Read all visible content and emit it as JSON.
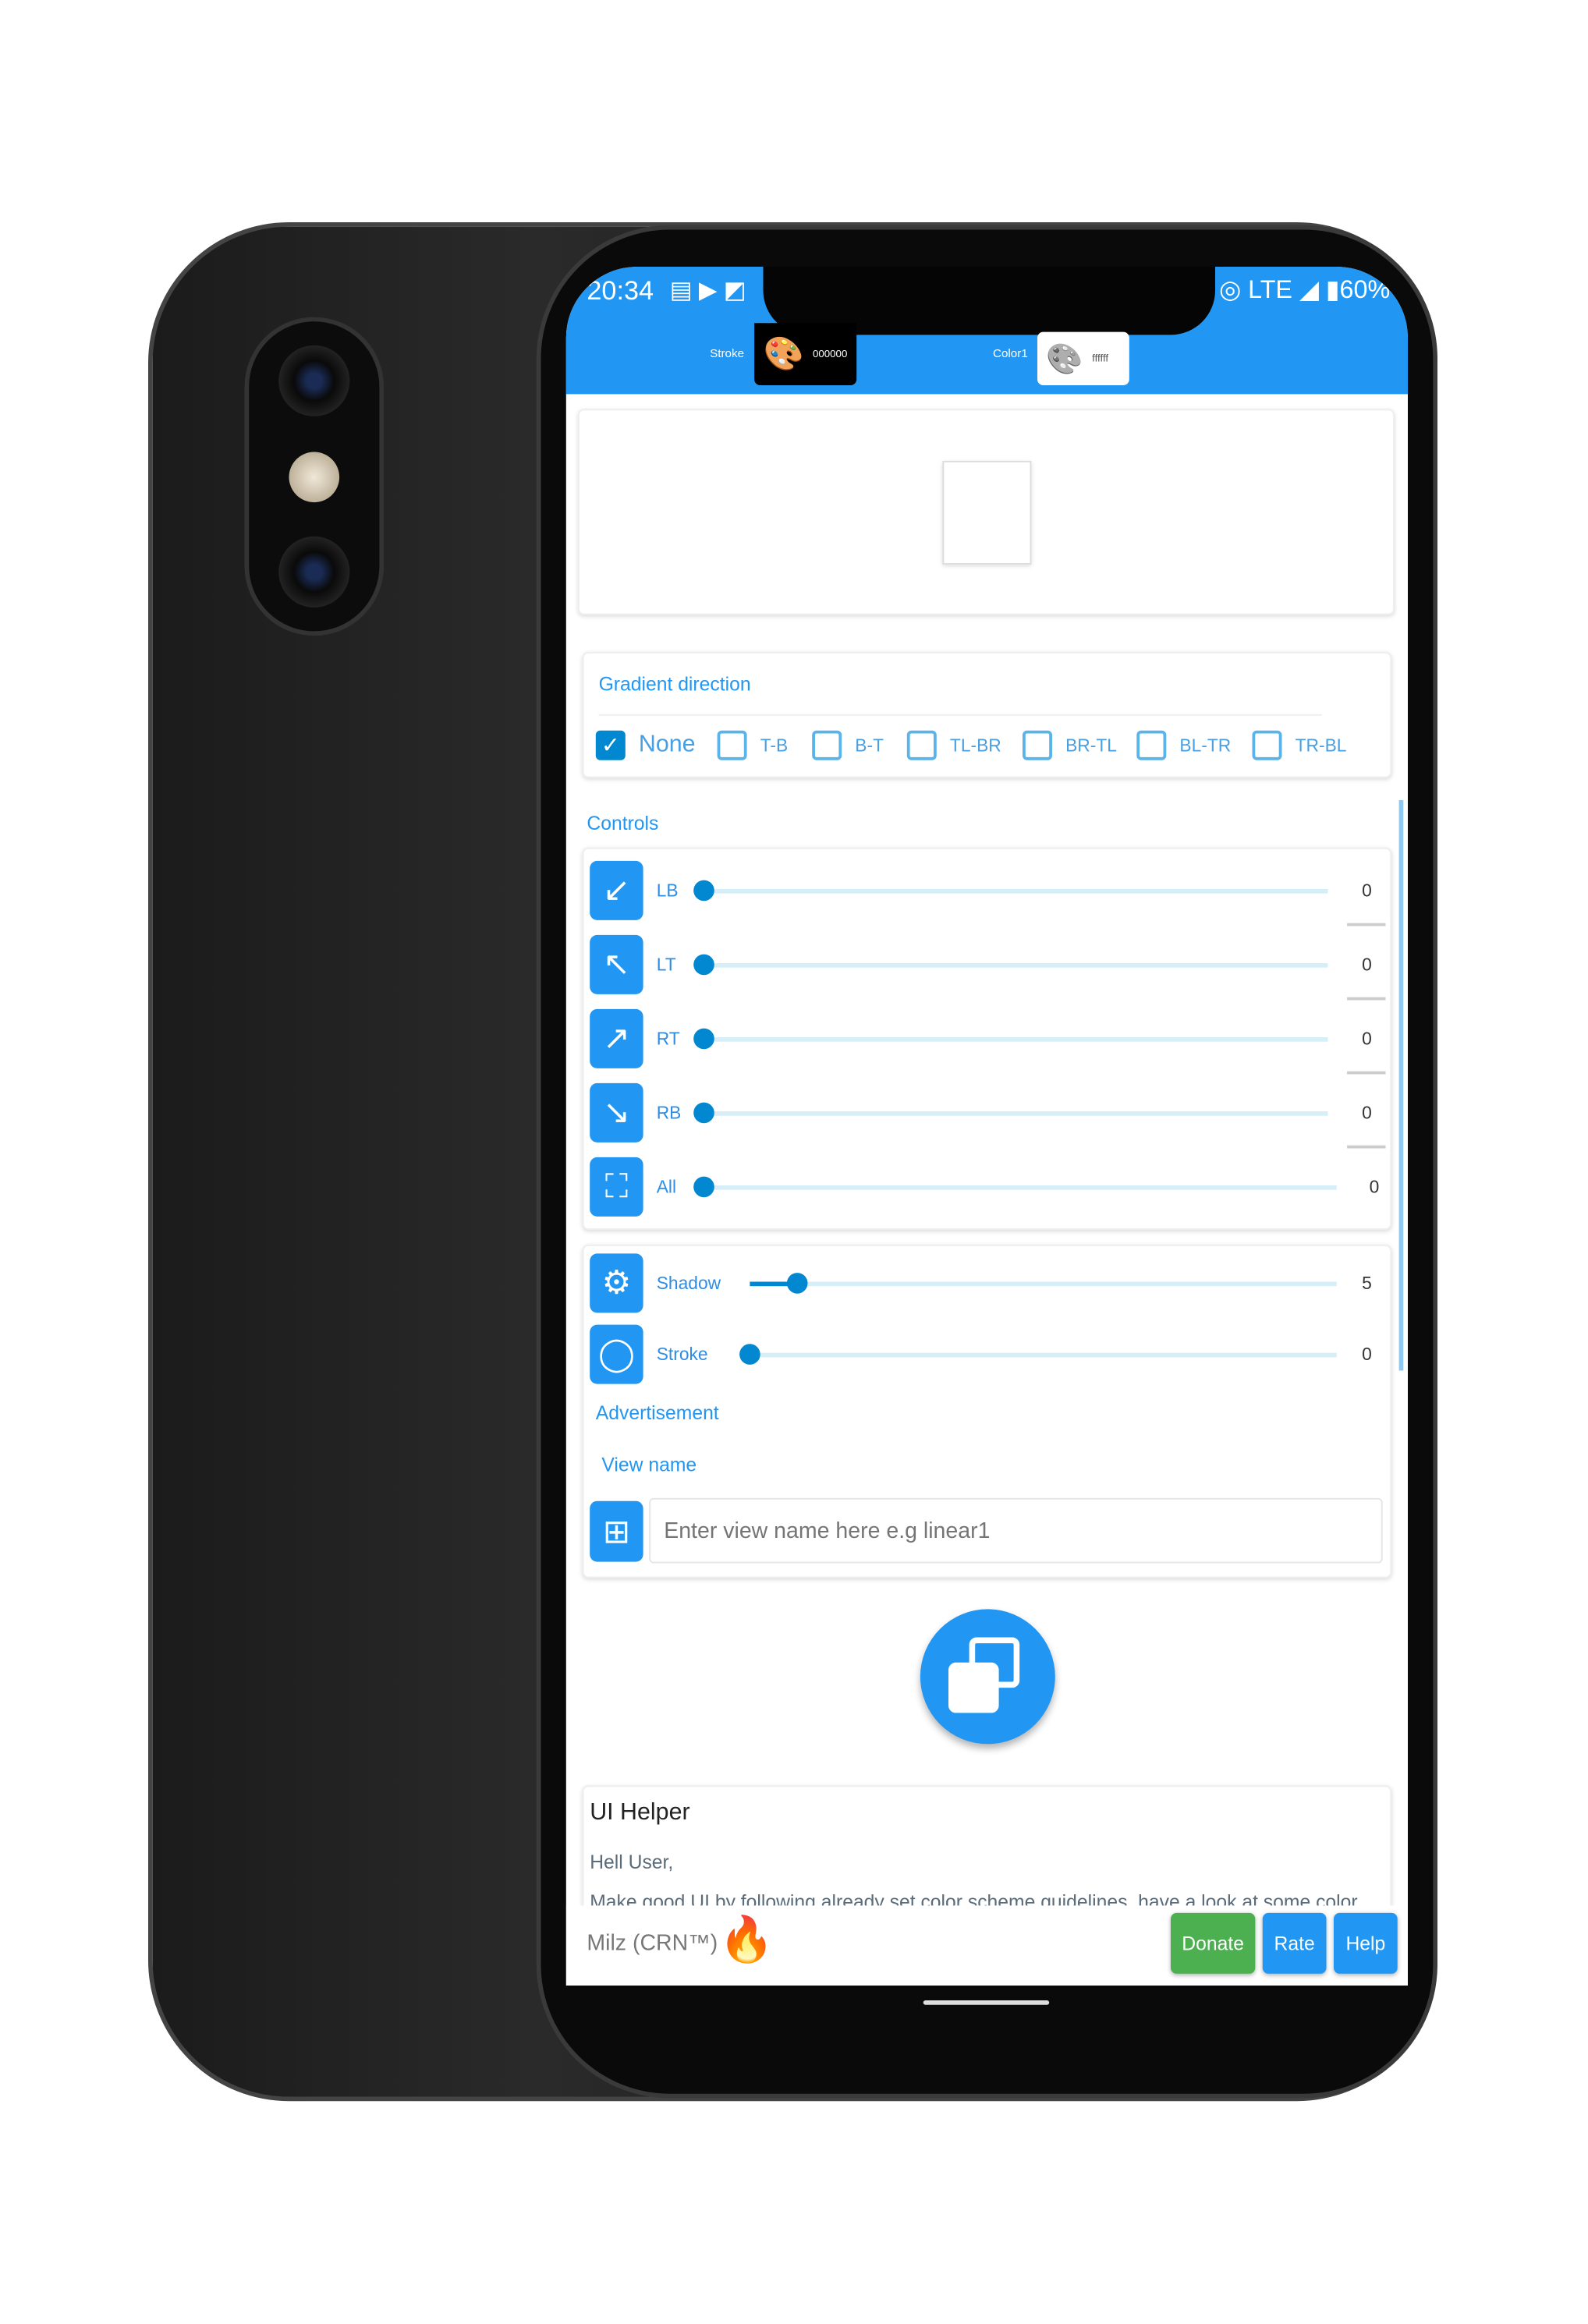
{
  "status_bar": {
    "time": "20:34",
    "network": "LTE",
    "battery": "60%"
  },
  "toolbar": {
    "stroke_label": "Stroke",
    "stroke_color": "000000",
    "color1_label": "Color1",
    "color1_color": "ffffff"
  },
  "gradient": {
    "title": "Gradient direction",
    "options": [
      {
        "label": "None",
        "checked": true
      },
      {
        "label": "T-B",
        "checked": false
      },
      {
        "label": "B-T",
        "checked": false
      },
      {
        "label": "TL-BR",
        "checked": false
      },
      {
        "label": "BR-TL",
        "checked": false
      },
      {
        "label": "BL-TR",
        "checked": false
      },
      {
        "label": "TR-BL",
        "checked": false
      }
    ]
  },
  "controls": {
    "title": "Controls",
    "rows": [
      {
        "label": "LB",
        "value": "0",
        "icon": "arrow-down-left-icon",
        "glyph": "↙"
      },
      {
        "label": "LT",
        "value": "0",
        "icon": "arrow-up-left-icon",
        "glyph": "↖"
      },
      {
        "label": "RT",
        "value": "0",
        "icon": "arrow-up-right-icon",
        "glyph": "↗"
      },
      {
        "label": "RB",
        "value": "0",
        "icon": "arrow-down-right-icon",
        "glyph": "↘"
      },
      {
        "label": "All",
        "value": "0",
        "icon": "fullscreen-icon",
        "glyph": "⛶"
      }
    ]
  },
  "effects": {
    "shadow": {
      "label": "Shadow",
      "value": "5",
      "fill": 0.08
    },
    "stroke": {
      "label": "Stroke",
      "value": "0",
      "fill": 0
    }
  },
  "advertisement": "Advertisement",
  "view_name": {
    "label": "View name",
    "placeholder": "Enter view name here e.g linear1"
  },
  "helper": {
    "title": "UI Helper",
    "greeting": "Hell User,",
    "body": "Make good UI by following already set color scheme guidelines, have a look at some color"
  },
  "footer": {
    "brand": "Milz (CRN™)",
    "donate": "Donate",
    "rate": "Rate",
    "help": "Help"
  },
  "colors": {
    "accent": "#2196f3",
    "thumb": "#0288d1",
    "donate": "#4caf50"
  }
}
